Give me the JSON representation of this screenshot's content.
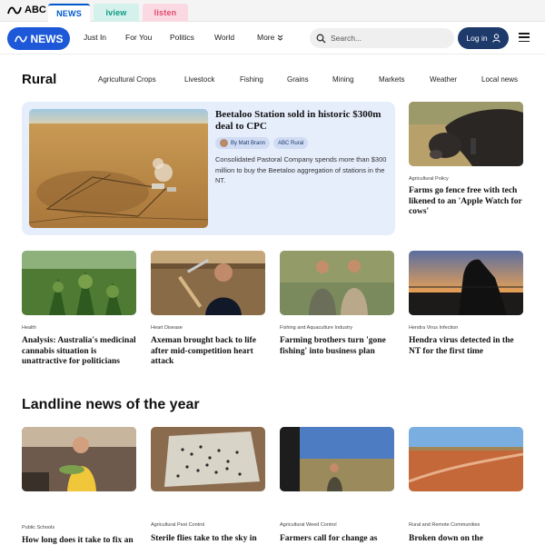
{
  "network_bar": {
    "brand": "ABC",
    "tabs": [
      {
        "label": "NEWS"
      },
      {
        "label": "iview"
      },
      {
        "label": "listen"
      }
    ]
  },
  "header": {
    "logo": "NEWS",
    "nav": [
      "Just In",
      "For You",
      "Politics",
      "World",
      "More"
    ],
    "search_placeholder": "Search...",
    "login": "Log in"
  },
  "section": {
    "title": "Rural",
    "subnav": [
      "Agricultural Crops",
      "Livestock",
      "Fishing",
      "Grains",
      "Mining",
      "Markets",
      "Weather",
      "Local news"
    ]
  },
  "feature": {
    "title": "Beetaloo Station sold in historic $300m deal to CPC",
    "author": "By Matt Brann",
    "tag": "ABC Rural",
    "description": "Consolidated Pastoral Company spends more than $300 million to buy the Beetaloo aggregation of stations in the NT."
  },
  "side_story": {
    "tag": "Agricultural Policy",
    "title": "Farms go fence free with tech likened to an 'Apple Watch for cows'"
  },
  "row1": [
    {
      "tag": "Health",
      "title": "Analysis: Australia's medicinal cannabis situation is unattractive for politicians"
    },
    {
      "tag": "Heart Disease",
      "title": "Axeman brought back to life after mid-competition heart attack"
    },
    {
      "tag": "Fishing and Aquaculture Industry",
      "title": "Farming brothers turn 'gone fishing' into business plan"
    },
    {
      "tag": "Hendra Virus Infection",
      "title": "Hendra virus detected in the NT for the first time"
    }
  ],
  "section2": {
    "title": "Landline news of the year"
  },
  "row2": [
    {
      "tag": "Public Schools",
      "title": "How long does it take to fix an"
    },
    {
      "tag": "Agricultural Pest Control",
      "title": "Sterile flies take to the sky in"
    },
    {
      "tag": "Agricultural Weed Control",
      "title": "Farmers call for change as"
    },
    {
      "tag": "Rural and Remote Communities",
      "title": "Broken down on the"
    }
  ],
  "colors": {
    "brand_blue": "#1d58d8",
    "login_navy": "#1d3a6b",
    "feature_bg": "#e6eefc"
  }
}
